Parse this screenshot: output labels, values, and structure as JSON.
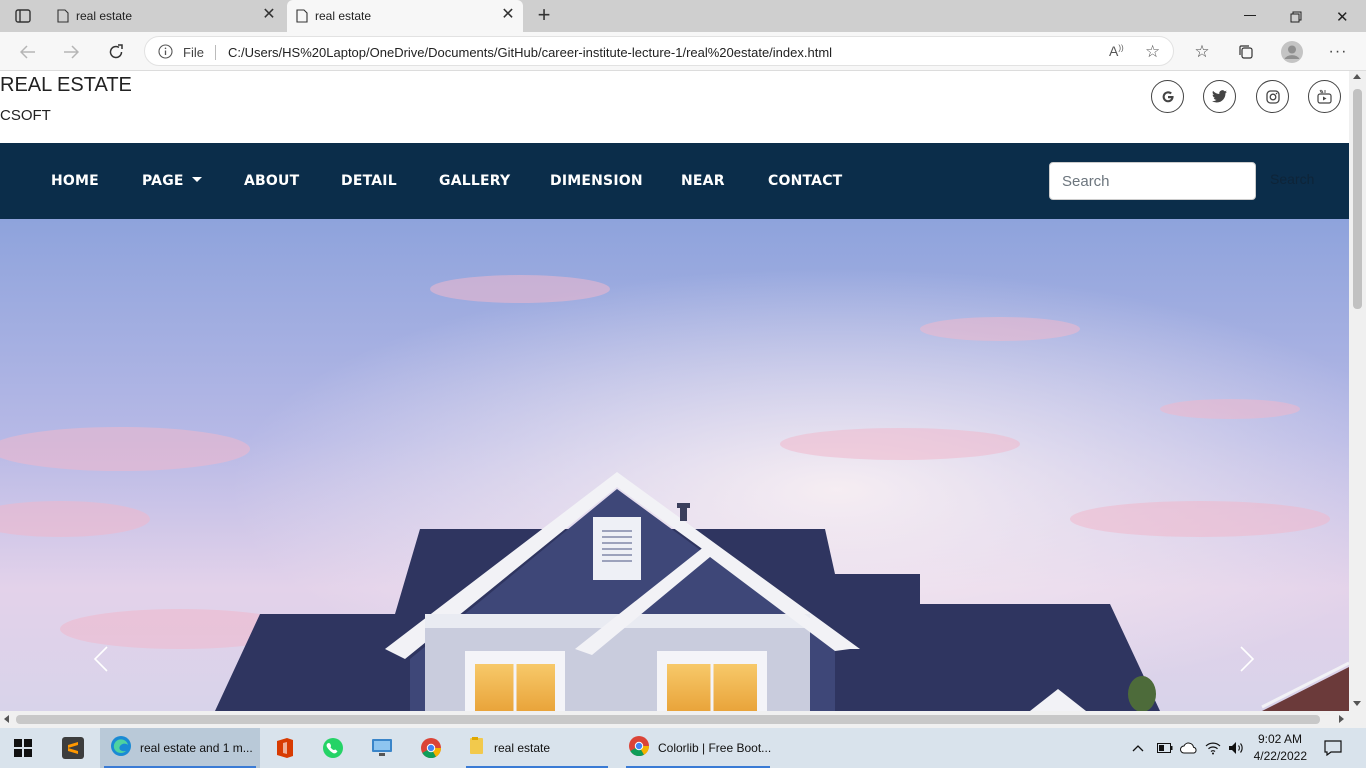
{
  "browser": {
    "tabs": [
      {
        "title": "real estate",
        "active": false
      },
      {
        "title": "real estate",
        "active": true
      }
    ],
    "address": {
      "scheme_label": "File",
      "url": "C:/Users/HS%20Laptop/OneDrive/Documents/GitHub/career-institute-lecture-1/real%20estate/index.html"
    }
  },
  "site": {
    "brand": {
      "title": "REAL ESTATE",
      "subtitle": "CSOFT"
    },
    "social_icons": [
      "google-icon",
      "twitter-icon",
      "instagram-icon",
      "youtube-icon"
    ],
    "nav": {
      "items": [
        {
          "label": "HOME"
        },
        {
          "label": "PAGE",
          "dropdown": true
        },
        {
          "label": "ABOUT"
        },
        {
          "label": "DETAIL"
        },
        {
          "label": "GALLERY"
        },
        {
          "label": "DIMENSION"
        },
        {
          "label": "NEAR"
        },
        {
          "label": "CONTACT"
        }
      ],
      "search_placeholder": "Search",
      "search_button": "Search"
    },
    "colors": {
      "navbar": "#0b2d4a",
      "nav_text": "#ffffff"
    }
  },
  "taskbar": {
    "items": [
      {
        "label": "real estate and 1 m...",
        "icon": "edge-icon",
        "active": true
      },
      {
        "label": "real estate",
        "icon": "folder-icon"
      },
      {
        "label": "Colorlib | Free Boot...",
        "icon": "chrome-icon"
      }
    ],
    "clock": {
      "time": "9:02 AM",
      "date": "4/22/2022"
    }
  }
}
